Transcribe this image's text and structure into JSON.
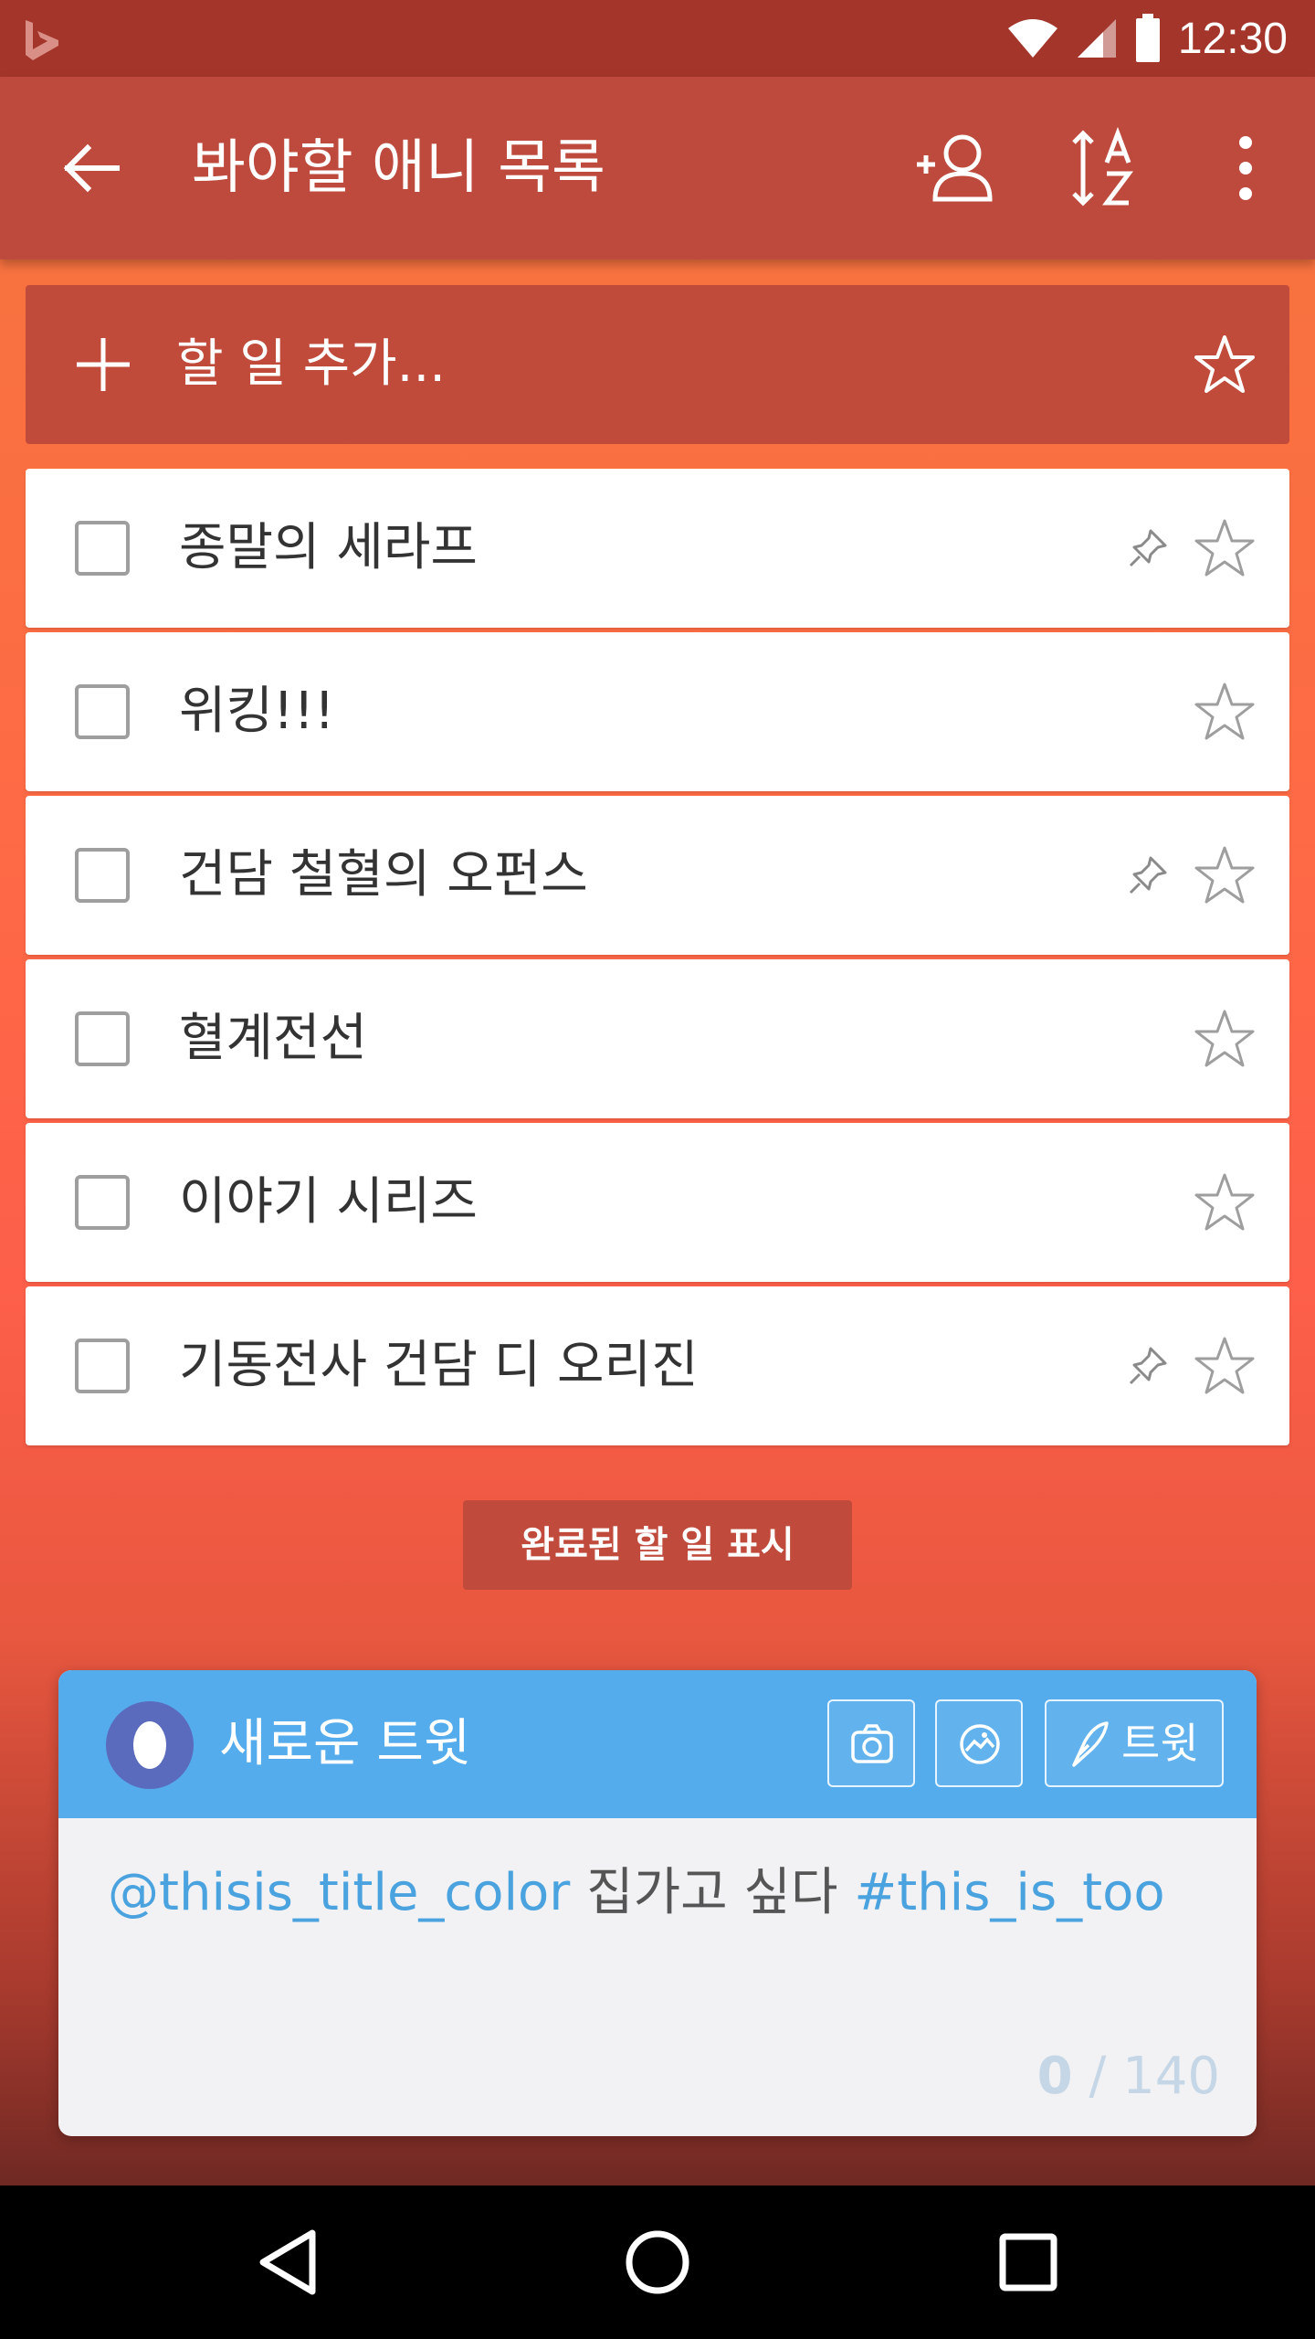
{
  "status_bar": {
    "time": "12:30"
  },
  "app_bar": {
    "title": "봐야할 애니 목록",
    "back_icon": "arrow-left-icon",
    "actions": [
      "add-person-icon",
      "sort-az-icon",
      "more-vert-icon"
    ]
  },
  "add_task": {
    "placeholder": "할 일 추가..."
  },
  "tasks": [
    {
      "title": "종말의 세라프",
      "pinned": true,
      "starred": false
    },
    {
      "title": "위킹!!!",
      "pinned": false,
      "starred": false
    },
    {
      "title": "건담 철혈의 오펀스",
      "pinned": true,
      "starred": false
    },
    {
      "title": "혈계전선",
      "pinned": false,
      "starred": false
    },
    {
      "title": "이야기 시리즈",
      "pinned": false,
      "starred": false
    },
    {
      "title": "기동전사 건담 디 오리진",
      "pinned": true,
      "starred": false
    }
  ],
  "show_completed_label": "완료된 할 일 표시",
  "tweet": {
    "header_title": "새로운 트윗",
    "tweet_button_label": "트윗",
    "mention": "@thisis_title_color",
    "text": " 집가고 싶다 ",
    "hashtag": "#this_is_too",
    "count_current": "0",
    "count_separator": " / ",
    "count_max": "140"
  },
  "colors": {
    "status_bar": "#a4352a",
    "app_bar": "#bd4a3c",
    "twitter_blue": "#55aced",
    "link": "#4aa3df"
  }
}
